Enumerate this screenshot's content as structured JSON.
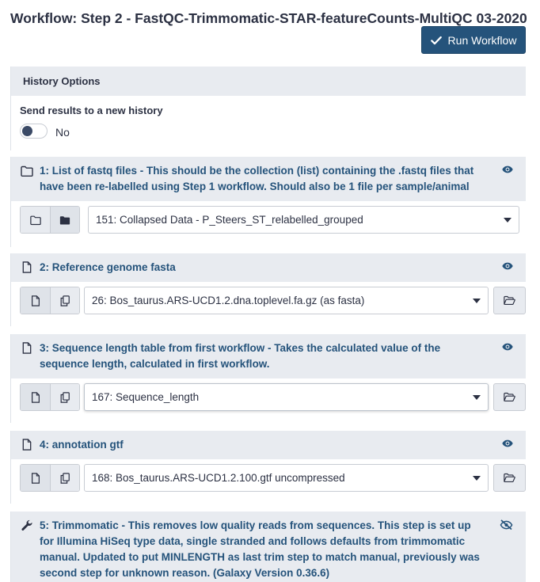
{
  "header": {
    "title": "Workflow: Step 2 - FastQC-Trimmomatic-STAR-featureCounts-MultiQC 03-2020",
    "run_label": "Run Workflow"
  },
  "history": {
    "title": "History Options",
    "send_label": "Send results to a new history",
    "toggle_value": "No"
  },
  "steps": [
    {
      "title": "1: List of fastq files - This should be the collection (list) containing the .fastq files that have been re-labelled using Step 1 workflow. Should also be 1 file per sample/animal",
      "icon": "folder-icon",
      "value": "151: Collapsed Data - P_Steers_ST_relabelled_grouped"
    },
    {
      "title": "2: Reference genome fasta",
      "icon": "file-icon",
      "value": "26: Bos_taurus.ARS-UCD1.2.dna.toplevel.fa.gz (as fasta)"
    },
    {
      "title": "3: Sequence length table from first workflow - Takes the calculated value of the sequence length, calculated in first workflow.",
      "icon": "file-icon",
      "value": "167: Sequence_length"
    },
    {
      "title": "4: annotation gtf",
      "icon": "file-icon",
      "value": "168: Bos_taurus.ARS-UCD1.2.100.gtf uncompressed"
    },
    {
      "title": "5: Trimmomatic - This removes low quality reads from sequences. This step is set up for Illumina HiSeq type data, single stranded and follows defaults from trimmomatic manual. Updated to put MINLENGTH as last trim step to match manual, previously was second step for unknown reason. (Galaxy Version 0.36.6)",
      "icon": "wrench-icon"
    }
  ],
  "colors": {
    "accent": "#25537b",
    "header_bg": "#e8ebf0",
    "text": "#2c3143"
  }
}
